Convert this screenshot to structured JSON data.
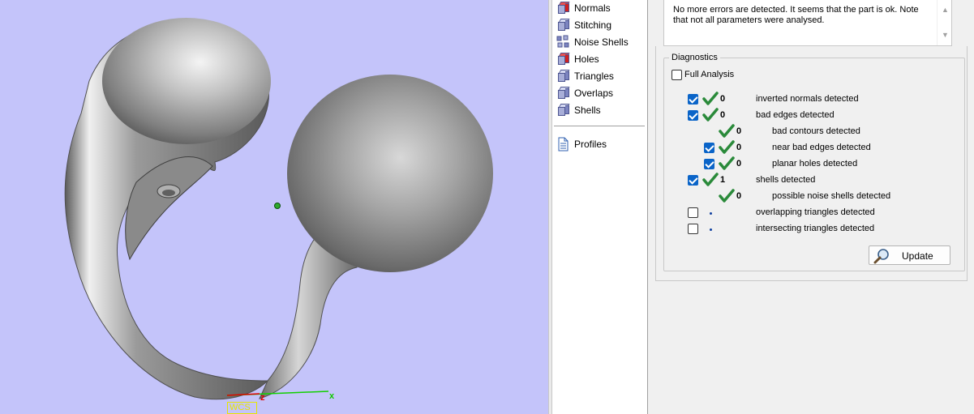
{
  "viewport": {
    "background": "#c4c4fa",
    "axes": {
      "x_label": "x",
      "z_label": "z",
      "wcs_label": "WCS"
    }
  },
  "tree": {
    "items": [
      {
        "label": "Normals",
        "icon": "normals-cube-icon"
      },
      {
        "label": "Stitching",
        "icon": "stitching-cube-icon"
      },
      {
        "label": "Noise Shells",
        "icon": "noise-shells-icon"
      },
      {
        "label": "Holes",
        "icon": "holes-cube-icon"
      },
      {
        "label": "Triangles",
        "icon": "triangles-cube-icon"
      },
      {
        "label": "Overlaps",
        "icon": "overlaps-cube-icon"
      },
      {
        "label": "Shells",
        "icon": "shells-cube-icon"
      }
    ],
    "profiles": {
      "label": "Profiles",
      "icon": "document-icon"
    }
  },
  "info": {
    "text": "No more errors are detected. It seems that the part is ok. Note that not all parameters were analysed."
  },
  "diagnostics": {
    "title": "Diagnostics",
    "full_analysis": {
      "label": "Full Analysis",
      "checked": false
    },
    "rows": [
      {
        "checkbox": true,
        "checked": true,
        "status": "ok",
        "count": "0",
        "label": "inverted normals detected",
        "indent": 0
      },
      {
        "checkbox": true,
        "checked": true,
        "status": "ok",
        "count": "0",
        "label": "bad edges detected",
        "indent": 0
      },
      {
        "checkbox": false,
        "checked": false,
        "status": "ok",
        "count": "0",
        "label": "bad contours detected",
        "indent": 1
      },
      {
        "checkbox": true,
        "checked": true,
        "status": "ok",
        "count": "0",
        "label": "near bad edges detected",
        "indent": 1
      },
      {
        "checkbox": true,
        "checked": true,
        "status": "ok",
        "count": "0",
        "label": "planar holes detected",
        "indent": 1
      },
      {
        "checkbox": true,
        "checked": true,
        "status": "ok",
        "count": "1",
        "label": "shells detected",
        "indent": 0
      },
      {
        "checkbox": false,
        "checked": false,
        "status": "ok",
        "count": "0",
        "label": "possible noise shells detected",
        "indent": 1
      },
      {
        "checkbox": true,
        "checked": false,
        "status": "pending",
        "count": "",
        "label": "overlapping triangles detected",
        "indent": 0
      },
      {
        "checkbox": true,
        "checked": false,
        "status": "pending",
        "count": "",
        "label": "intersecting triangles detected",
        "indent": 0
      }
    ],
    "update_button": {
      "label": "Update",
      "icon": "magnifier-icon"
    }
  },
  "colors": {
    "check_green": "#2a8a3a",
    "checkbox_blue": "#0a64c8"
  }
}
